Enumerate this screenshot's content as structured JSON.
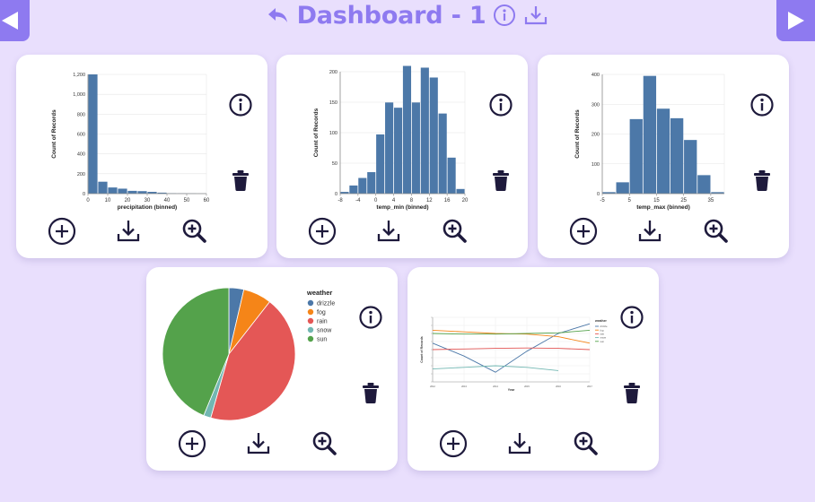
{
  "header": {
    "title": "Dashboard - 1"
  },
  "icons": {
    "nav_left": "triangle-left-icon",
    "nav_right": "triangle-right-icon",
    "undo": "undo-arrow-icon",
    "info": "info-circle-icon",
    "download": "download-icon",
    "add": "plus-circle-icon",
    "zoom": "zoom-in-icon",
    "trash": "trash-icon"
  },
  "colors": {
    "accent": "#8e7af0",
    "background": "#e9dffd",
    "bar": "#4c78a8",
    "icon": "#1e1a3c"
  },
  "chart_data": [
    {
      "type": "bar",
      "xlabel": "precipitation (binned)",
      "ylabel": "Count of Records",
      "x_bins": [
        0,
        5,
        10,
        15,
        20,
        25,
        30,
        35,
        40,
        45,
        50,
        55
      ],
      "values": [
        1200,
        120,
        62,
        50,
        28,
        25,
        18,
        10,
        4,
        3,
        2,
        1
      ],
      "xticks": [
        "0",
        "10",
        "20",
        "30",
        "40",
        "50",
        "60"
      ],
      "yticks": [
        "0",
        "200",
        "400",
        "600",
        "800",
        "1,000",
        "1,200"
      ],
      "xlim": [
        0,
        60
      ],
      "ylim": [
        0,
        1200
      ]
    },
    {
      "type": "bar",
      "xlabel": "temp_min (binned)",
      "ylabel": "Count of Records",
      "x_bins": [
        -8,
        -6,
        -4,
        -2,
        0,
        2,
        4,
        6,
        8,
        10,
        12,
        14,
        16,
        18
      ],
      "values": [
        3,
        14,
        27,
        37,
        102,
        157,
        148,
        220,
        157,
        217,
        200,
        138,
        62,
        8
      ],
      "xticks": [
        "-8",
        "-4",
        "0",
        "4",
        "8",
        "12",
        "16",
        "20"
      ],
      "yticks": [
        "0",
        "50",
        "100",
        "150",
        "200"
      ],
      "xlim": [
        -8,
        20
      ],
      "ylim": [
        0,
        210
      ]
    },
    {
      "type": "bar",
      "xlabel": "temp_max (binned)",
      "ylabel": "Count of Records",
      "x_bins": [
        -5,
        0,
        5,
        10,
        15,
        20,
        25,
        30,
        35
      ],
      "values": [
        5,
        38,
        250,
        395,
        285,
        253,
        180,
        62,
        5
      ],
      "xticks": [
        "-5",
        "5",
        "15",
        "25",
        "35"
      ],
      "yticks": [
        "0",
        "100",
        "200",
        "300",
        "400"
      ],
      "xlim": [
        -5,
        40
      ],
      "ylim": [
        0,
        400
      ]
    },
    {
      "type": "pie",
      "legend_title": "weather",
      "legend_position": "top-right",
      "slices": [
        {
          "label": "drizzle",
          "value": 53,
          "color": "#4c78a8"
        },
        {
          "label": "fog",
          "value": 101,
          "color": "#f58518"
        },
        {
          "label": "rain",
          "value": 641,
          "color": "#e45756"
        },
        {
          "label": "snow",
          "value": 26,
          "color": "#72b7b2"
        },
        {
          "label": "sun",
          "value": 640,
          "color": "#54a24b"
        }
      ]
    },
    {
      "type": "line",
      "xlabel": "Year",
      "ylabel": "Count of Records",
      "legend_title": "weather",
      "legend_position": "top-right",
      "x": [
        2012,
        2013,
        2014,
        2015,
        2016,
        2017
      ],
      "ylim": [
        0,
        200
      ],
      "series": [
        {
          "name": "drizzle",
          "color": "#4c78a8",
          "values": [
            120,
            80,
            30,
            95,
            150,
            180
          ]
        },
        {
          "name": "fog",
          "color": "#f58518",
          "values": [
            160,
            155,
            150,
            148,
            140,
            120
          ]
        },
        {
          "name": "rain",
          "color": "#e45756",
          "values": [
            100,
            102,
            104,
            105,
            104,
            100
          ]
        },
        {
          "name": "snow",
          "color": "#72b7b2",
          "values": [
            40,
            45,
            50,
            45,
            35,
            null
          ]
        },
        {
          "name": "sun",
          "color": "#54a24b",
          "values": [
            150,
            148,
            148,
            150,
            152,
            160
          ]
        }
      ]
    }
  ]
}
